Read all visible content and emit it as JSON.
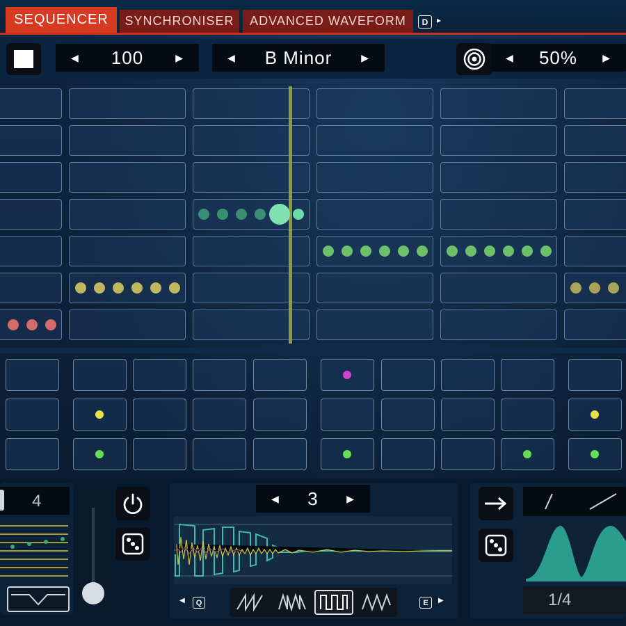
{
  "tabs": [
    {
      "label": "SEQUENCER",
      "active": true
    },
    {
      "label": "SYNCHRONISER",
      "active": false
    },
    {
      "label": "ADVANCED WAVEFORM",
      "active": false
    }
  ],
  "tab_extra_key": "D",
  "toolbar": {
    "tempo": "100",
    "scale": "B Minor",
    "percent": "50%"
  },
  "bottom": {
    "left_value": "4",
    "center_value": "3",
    "q_key": "Q",
    "e_key": "E",
    "rate": "1/4"
  },
  "colors": {
    "accent": "#d63a21",
    "teal": "#2a9d8f",
    "green_dot": "#66dd55",
    "yellow_dot": "#e8e04a",
    "magenta_dot": "#cc44cc",
    "red_dot": "#e07070"
  }
}
